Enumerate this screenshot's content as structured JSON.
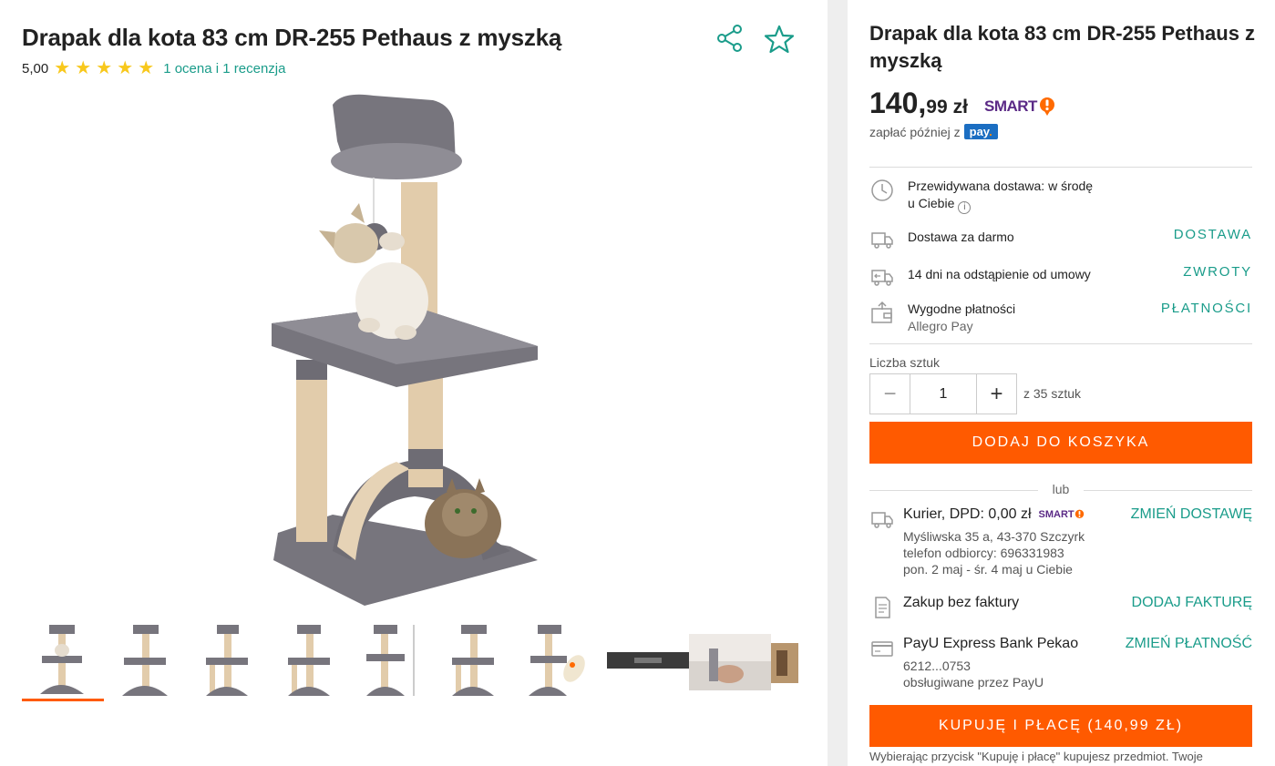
{
  "product": {
    "title": "Drapak dla kota 83 cm DR-255 Pethaus z myszką",
    "rating_score": "5,00",
    "rating_link": "1 ocena i 1 recenzja",
    "stars": 5
  },
  "price": {
    "integer": "140,",
    "decimal": "99",
    "currency": "zł",
    "smart_label": "SMART",
    "pay_later_text": "zapłać później z",
    "pay_badge": "pay"
  },
  "info": {
    "delivery_estimate": "Przewidywana dostawa: w środę",
    "delivery_estimate_2": "u Ciebie",
    "free_delivery": "Dostawa za darmo",
    "free_delivery_link": "DOSTAWA",
    "returns": "14 dni na odstąpienie od umowy",
    "returns_link": "ZWROTY",
    "payments": "Wygodne płatności",
    "payments_sub": "Allegro Pay",
    "payments_link": "PŁATNOŚCI"
  },
  "quantity": {
    "label": "Liczba sztuk",
    "value": "1",
    "of_text": "z 35 sztuk",
    "minus": "−",
    "plus": "+"
  },
  "buttons": {
    "add_to_cart": "DODAJ DO KOSZYKA",
    "or": "lub",
    "buy_now": "KUPUJĘ I PŁACĘ (140,99 ZŁ)"
  },
  "shipping": {
    "courier": "Kurier, DPD: 0,00 zł",
    "courier_link": "ZMIEŃ DOSTAWĘ",
    "address": "Myśliwska 35 a, 43-370 Szczyrk",
    "phone": "telefon odbiorcy: 696331983",
    "eta": "pon. 2 maj - śr. 4 maj u Ciebie",
    "invoice": "Zakup bez faktury",
    "invoice_link": "DODAJ FAKTURĘ",
    "payment": "PayU Express Bank Pekao",
    "payment_link": "ZMIEŃ PŁATNOŚĆ",
    "card": "6212...0753",
    "served_by": "obsługiwane przez PayU"
  },
  "disclaimer": "Wybierając przycisk \"Kupuję i płacę\" kupujesz przedmiot. Twoje",
  "colors": {
    "accent": "#ff5a00",
    "link": "#1a9c8a",
    "star": "#f8c81c",
    "smart": "#5b2a86"
  },
  "icons": {
    "share": "share-icon",
    "favorite": "star-outline-icon",
    "clock": "clock-icon",
    "truck": "truck-icon",
    "return": "return-truck-icon",
    "wallet": "wallet-icon",
    "invoice": "document-icon",
    "card": "credit-card-icon"
  }
}
